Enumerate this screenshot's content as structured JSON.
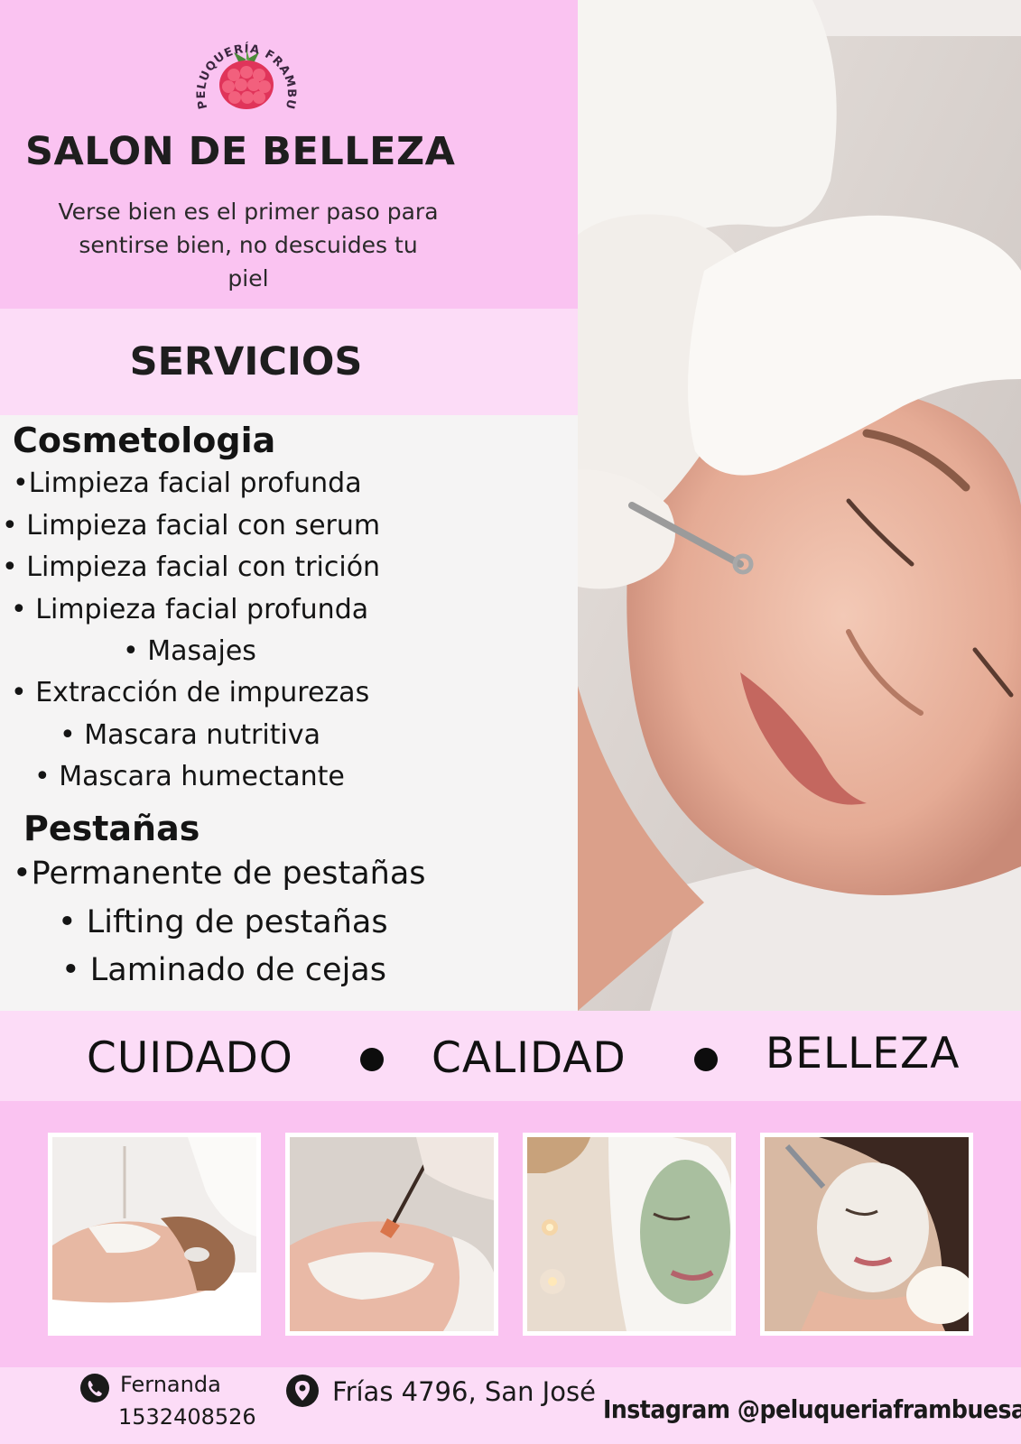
{
  "brand": {
    "logo_ring_text": "PELUQUERÍA FRAMBUESA",
    "raspberry_icon": "raspberry-icon"
  },
  "header": {
    "title": "SALON DE BELLEZA",
    "tagline_lines": [
      "Verse bien es el primer paso para",
      "sentirse bien, no descuides tu",
      "piel"
    ]
  },
  "services": {
    "title": "SERVICIOS",
    "categories": [
      {
        "name": "Cosmetologia",
        "items": [
          "•Limpieza facial profunda",
          "• Limpieza facial con serum",
          "• Limpieza facial con trición",
          "• Limpieza facial profunda",
          "• Masajes",
          "• Extracción de impurezas",
          "• Mascara nutritiva",
          "• Mascara humectante"
        ]
      },
      {
        "name": "Pestañas",
        "items": [
          "•Permanente de pestañas",
          "• Lifting de pestañas",
          "• Laminado de cejas"
        ]
      }
    ]
  },
  "values": [
    "CUIDADO",
    "CALIDAD",
    "BELLEZA"
  ],
  "footer": {
    "phone_icon": "phone-icon",
    "contact_name": "Fernanda",
    "phone": "1532408526",
    "location_icon": "location-pin-icon",
    "address": "Frías 4796, San José",
    "instagram": "Instagram @peluqueriaframbuesa"
  },
  "colors": {
    "pink_primary": "#fac3f1",
    "pink_light": "#fcdcf7",
    "panel_gray": "#f5f4f4",
    "raspberry": "#e0345a",
    "leaf_green": "#4c8a3a",
    "text_dark": "#1e1e1e"
  }
}
